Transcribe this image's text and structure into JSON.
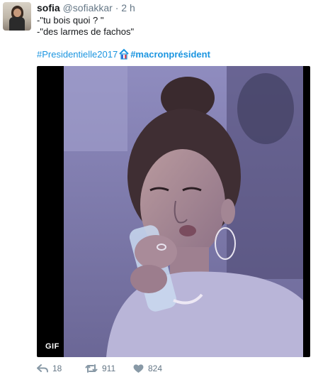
{
  "tweet": {
    "user": {
      "name": "sofia",
      "handle": "@sofiakkar",
      "separator": "·",
      "time": "2 h"
    },
    "text": {
      "line1": "-\"tu bois quoi ? \"",
      "line2": "-\"des larmes de fachos\""
    },
    "hashtags": {
      "first": "#Presidentielle2017",
      "second": "#macronprésident"
    },
    "media": {
      "badge": "GIF"
    },
    "actions": {
      "reply_count": "18",
      "retweet_count": "911",
      "like_count": "824"
    }
  },
  "colors": {
    "link": "#1b95e0",
    "secondary_text": "#657786",
    "primary_text": "#14171a"
  },
  "icons": {
    "reply": "reply-icon",
    "retweet": "retweet-icon",
    "like": "heart-icon",
    "hashflag": "macron-hashflag-icon"
  }
}
